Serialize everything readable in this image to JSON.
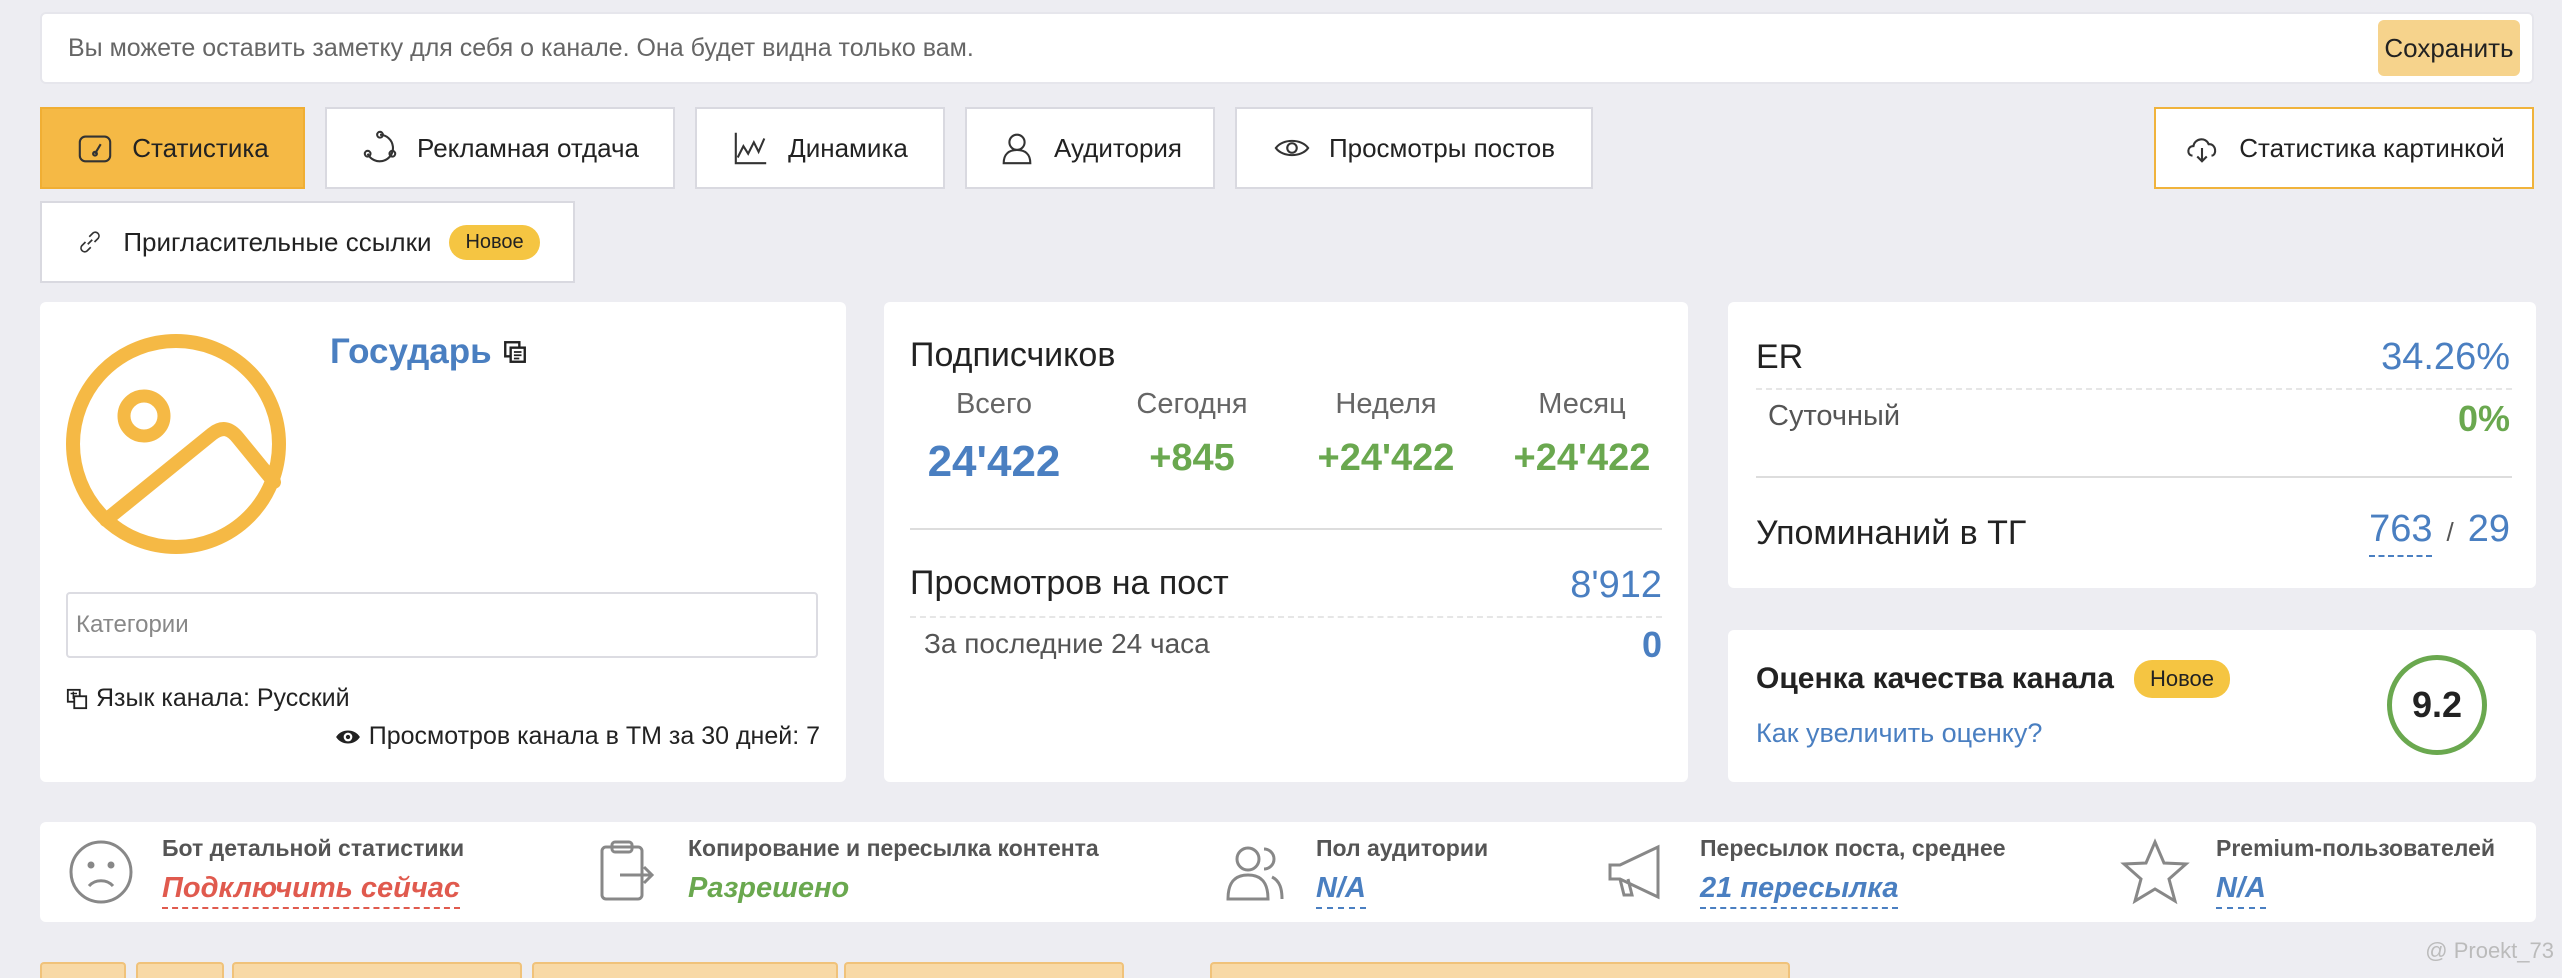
{
  "note": {
    "placeholder": "Вы можете оставить заметку для себя о канале. Она будет видна только вам.",
    "save_label": "Сохранить"
  },
  "tabs": [
    {
      "label": "Статистика",
      "icon": "speedometer-icon",
      "active": true
    },
    {
      "label": "Рекламная отдача",
      "icon": "cycle-icon",
      "active": false
    },
    {
      "label": "Динамика",
      "icon": "line-chart-icon",
      "active": false
    },
    {
      "label": "Аудитория",
      "icon": "user-icon",
      "active": false
    },
    {
      "label": "Просмотры постов",
      "icon": "eye-icon",
      "active": false
    },
    {
      "label": "Пригласительные ссылки",
      "icon": "link-icon",
      "active": false,
      "badge": "Новое"
    }
  ],
  "stats_image_button": {
    "label": "Статистика картинкой",
    "icon": "cloud-download-icon"
  },
  "channel": {
    "name": "Государь",
    "category_placeholder": "Категории",
    "language": "Язык канала: Русский",
    "views_tm": "Просмотров канала в ТМ за 30 дней: 7"
  },
  "subscribers": {
    "title": "Подписчиков",
    "columns": [
      {
        "label": "Всего",
        "value": "24'422"
      },
      {
        "label": "Сегодня",
        "value": "+845"
      },
      {
        "label": "Неделя",
        "value": "+24'422"
      },
      {
        "label": "Месяц",
        "value": "+24'422"
      }
    ],
    "views_per_post": {
      "label": "Просмотров на пост",
      "value": "8'912"
    },
    "last_24h": {
      "label": "За последние 24 часа",
      "value": "0"
    }
  },
  "er": {
    "label": "ER",
    "value": "34.26%",
    "daily_label": "Суточный",
    "daily_value": "0%",
    "mentions_label": "Упоминаний в ТГ",
    "mentions_value": "763",
    "mentions_sep": "/",
    "mentions_value2": "29"
  },
  "quality": {
    "title": "Оценка качества канала",
    "badge": "Новое",
    "link": "Как увеличить оценку?",
    "score": "9.2"
  },
  "features": [
    {
      "title": "Бот детальной статистики",
      "value": "Подключить сейчас",
      "color": "#e05a4e",
      "icon": "sad-face-icon"
    },
    {
      "title": "Копирование и пересылка контента",
      "value": "Разрешено",
      "color": "#6aa84f",
      "icon": "clipboard-forward-icon"
    },
    {
      "title": "Пол аудитории",
      "value": "N/A",
      "color": "#4a7fc1",
      "icon": "users-icon"
    },
    {
      "title": "Пересылок поста, среднее",
      "value": "21 пересылка",
      "color": "#4a7fc1",
      "icon": "megaphone-icon"
    },
    {
      "title": "Premium-пользователей",
      "value": "N/A",
      "color": "#4a7fc1",
      "icon": "star-icon"
    }
  ],
  "watermark": "@ Proekt_73",
  "colors": {
    "accent": "#f5b945",
    "blue": "#4a7fc1",
    "green": "#6aa84f",
    "red": "#e05a4e"
  }
}
